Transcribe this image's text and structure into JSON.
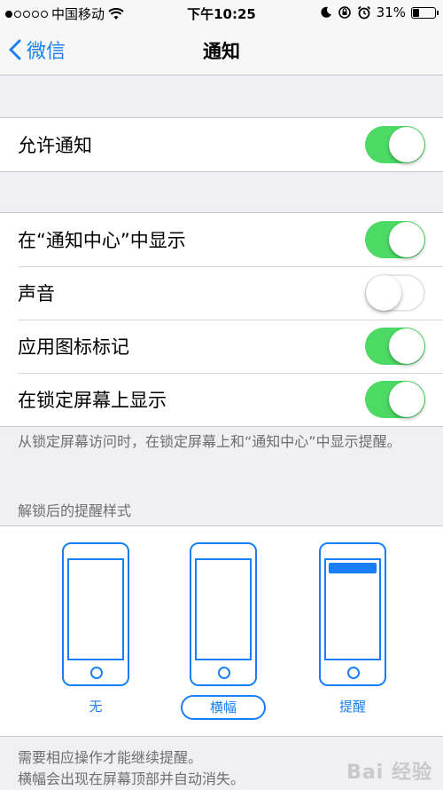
{
  "status_bar": {
    "carrier": "中国移动",
    "time": "下午10:25",
    "battery": "31%",
    "battery_level": 0.31,
    "signal_bars_filled": 1,
    "signal_bars_total": 5
  },
  "nav": {
    "back_label": "微信",
    "title": "通知"
  },
  "group1": [
    {
      "label": "允许通知",
      "on": true
    }
  ],
  "group2": [
    {
      "label": "在“通知中心”中显示",
      "on": true
    },
    {
      "label": "声音",
      "on": false
    },
    {
      "label": "应用图标标记",
      "on": true
    },
    {
      "label": "在锁定屏幕上显示",
      "on": true
    }
  ],
  "group2_footer": "从锁定屏幕访问时，在锁定屏幕上和“通知中心”中显示提醒。",
  "alert_style": {
    "header": "解锁后的提醒样式",
    "options": [
      {
        "label": "无",
        "selected": false
      },
      {
        "label": "横幅",
        "selected": true
      },
      {
        "label": "提醒",
        "selected": false
      }
    ],
    "footer_line1": "需要相应操作才能继续提醒。",
    "footer_line2": "横幅会出现在屏幕顶部并自动消失。"
  },
  "watermark": "Bai 经验",
  "colors": {
    "accent": "#1a7ff5",
    "toggle_on": "#4cd964"
  }
}
